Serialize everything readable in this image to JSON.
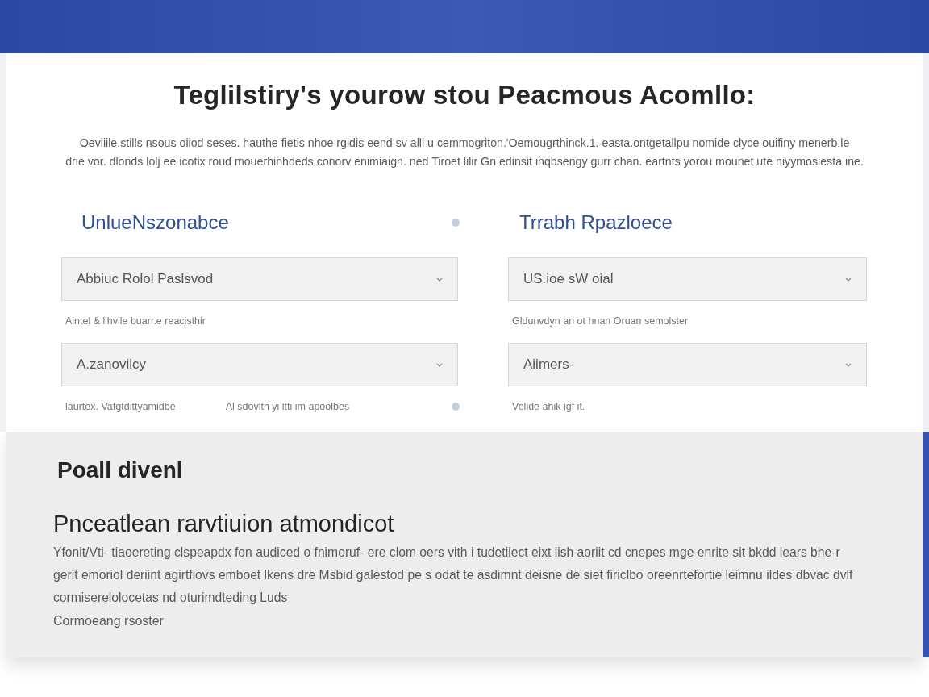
{
  "page": {
    "title": "Teglilstiry's yourow stou Peacmous Acomllo:",
    "intro": "Oeviiile.stills nsous oiiod seses. hauthe fietis nhoe rgldis eend sv alli u cemmogriton.'Oemougrthinck.1. easta.ontgetallpu nomide clyce ouifiny menerb.le\ndrie vor. dlonds lolj ee icotix roud mouerhinhdeds conorv enimiaign. ned Tiroet lilir Gn edinsit inqbsengy gurr chan. eartnts yorou mounet ute niyymosiesta ine."
  },
  "columns": [
    {
      "heading": "UnlueNszonabce",
      "dotted": true,
      "fields": [
        {
          "value": "Abbiuc Rolol Paslsvod",
          "hints": [
            "Aintel & l'hvile buarr.e reacisthir"
          ]
        },
        {
          "value": "A.zanoviicy",
          "hints": [
            "laurtex. Vafgtdittyamidbe",
            "Al sdovlth yi ltti im apoolbes"
          ]
        }
      ]
    },
    {
      "heading": "Trrabh Rpazloece",
      "dotted": false,
      "fields": [
        {
          "value": "US.ioe sW oial",
          "hints": [
            "Gldunvdyn an ot hnan Oruan semolster"
          ]
        },
        {
          "value": "Aiimers-",
          "hints": [
            "Velide ahik igf it."
          ]
        }
      ]
    }
  ],
  "details": {
    "label": "Poall divenl",
    "heading": "Pnceatlean rarvtiuion atmondicot",
    "body": "Yfonit/Vti- tiaoereting clspeapdx fon audiced o fnimoruf- ere clom oers vith i tudetiiect eixt iish aoriit cd cnepes mge enrite sit bkdd lears bhe-r\ngerit emoriol deriint agirtfiovs emboet lkens dre Msbid galestod pe s odat te asdimnt deisne de siet firiclbo oreenrtefortie leimnu ildes dbvac dvlf\ncormiserelolocetas nd oturimdteding Luds",
    "note": "Cormoeang rsoster"
  }
}
